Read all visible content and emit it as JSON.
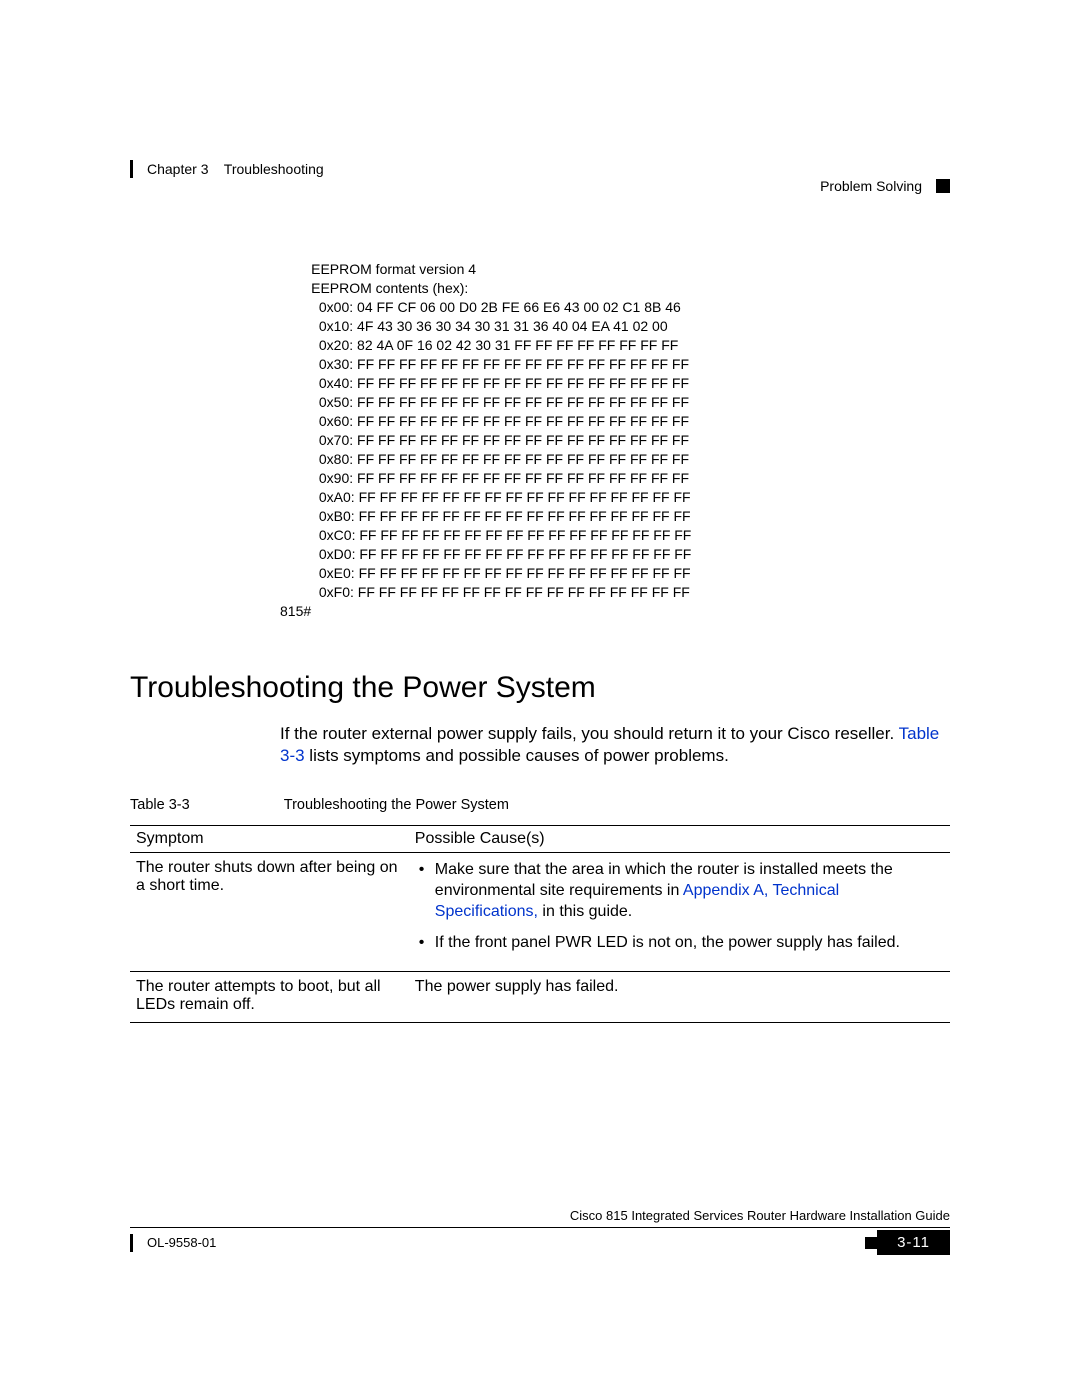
{
  "header": {
    "chapter": "Chapter 3",
    "title": "Troubleshooting",
    "right": "Problem Solving"
  },
  "code": "        EEPROM format version 4\n        EEPROM contents (hex):\n          0x00: 04 FF CF 06 00 D0 2B FE 66 E6 43 00 02 C1 8B 46\n          0x10: 4F 43 30 36 30 34 30 31 31 36 40 04 EA 41 02 00\n          0x20: 82 4A 0F 16 02 42 30 31 FF FF FF FF FF FF FF FF\n          0x30: FF FF FF FF FF FF FF FF FF FF FF FF FF FF FF FF\n          0x40: FF FF FF FF FF FF FF FF FF FF FF FF FF FF FF FF\n          0x50: FF FF FF FF FF FF FF FF FF FF FF FF FF FF FF FF\n          0x60: FF FF FF FF FF FF FF FF FF FF FF FF FF FF FF FF\n          0x70: FF FF FF FF FF FF FF FF FF FF FF FF FF FF FF FF\n          0x80: FF FF FF FF FF FF FF FF FF FF FF FF FF FF FF FF\n          0x90: FF FF FF FF FF FF FF FF FF FF FF FF FF FF FF FF\n          0xA0: FF FF FF FF FF FF FF FF FF FF FF FF FF FF FF FF\n          0xB0: FF FF FF FF FF FF FF FF FF FF FF FF FF FF FF FF\n          0xC0: FF FF FF FF FF FF FF FF FF FF FF FF FF FF FF FF\n          0xD0: FF FF FF FF FF FF FF FF FF FF FF FF FF FF FF FF\n          0xE0: FF FF FF FF FF FF FF FF FF FF FF FF FF FF FF FF\n          0xF0: FF FF FF FF FF FF FF FF FF FF FF FF FF FF FF FF\n815#",
  "section": {
    "heading": "Troubleshooting the Power System",
    "para_prefix": "If the router external power supply fails, you should return it to your Cisco reseller. ",
    "para_link": "Table 3-3",
    "para_suffix": " lists symptoms and possible causes of power problems."
  },
  "table": {
    "caption_label": "Table 3-3",
    "caption_title": "Troubleshooting the Power System",
    "col1": "Symptom",
    "col2": "Possible Cause(s)",
    "rows": [
      {
        "symptom": "The router shuts down after being on a short time.",
        "cause_bullets": [
          {
            "pre": "Make sure that the area in which the router is installed meets the environmental site requirements in ",
            "link": "Appendix A, Technical Specifications,",
            "post": " in this guide."
          },
          {
            "pre": "If the front panel PWR LED is not on, the power supply has failed.",
            "link": "",
            "post": ""
          }
        ]
      },
      {
        "symptom": "The router attempts to boot, but all LEDs remain off.",
        "cause_plain": "The power supply has failed."
      }
    ]
  },
  "footer": {
    "guide": "Cisco 815 Integrated Services Router Hardware Installation Guide",
    "doc": "OL-9558-01",
    "page": "3-11"
  }
}
